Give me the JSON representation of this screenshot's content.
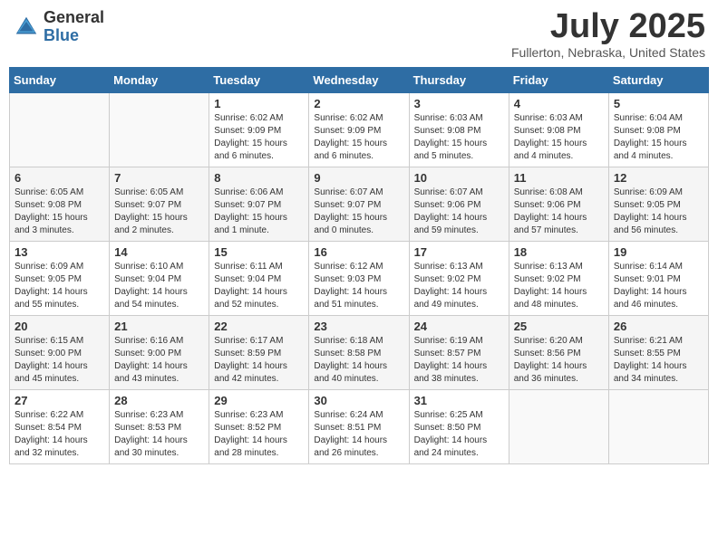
{
  "header": {
    "logo_general": "General",
    "logo_blue": "Blue",
    "month_year": "July 2025",
    "location": "Fullerton, Nebraska, United States"
  },
  "days_of_week": [
    "Sunday",
    "Monday",
    "Tuesday",
    "Wednesday",
    "Thursday",
    "Friday",
    "Saturday"
  ],
  "weeks": [
    [
      {
        "day": "",
        "sunrise": "",
        "sunset": "",
        "daylight": ""
      },
      {
        "day": "",
        "sunrise": "",
        "sunset": "",
        "daylight": ""
      },
      {
        "day": "1",
        "sunrise": "Sunrise: 6:02 AM",
        "sunset": "Sunset: 9:09 PM",
        "daylight": "Daylight: 15 hours and 6 minutes."
      },
      {
        "day": "2",
        "sunrise": "Sunrise: 6:02 AM",
        "sunset": "Sunset: 9:09 PM",
        "daylight": "Daylight: 15 hours and 6 minutes."
      },
      {
        "day": "3",
        "sunrise": "Sunrise: 6:03 AM",
        "sunset": "Sunset: 9:08 PM",
        "daylight": "Daylight: 15 hours and 5 minutes."
      },
      {
        "day": "4",
        "sunrise": "Sunrise: 6:03 AM",
        "sunset": "Sunset: 9:08 PM",
        "daylight": "Daylight: 15 hours and 4 minutes."
      },
      {
        "day": "5",
        "sunrise": "Sunrise: 6:04 AM",
        "sunset": "Sunset: 9:08 PM",
        "daylight": "Daylight: 15 hours and 4 minutes."
      }
    ],
    [
      {
        "day": "6",
        "sunrise": "Sunrise: 6:05 AM",
        "sunset": "Sunset: 9:08 PM",
        "daylight": "Daylight: 15 hours and 3 minutes."
      },
      {
        "day": "7",
        "sunrise": "Sunrise: 6:05 AM",
        "sunset": "Sunset: 9:07 PM",
        "daylight": "Daylight: 15 hours and 2 minutes."
      },
      {
        "day": "8",
        "sunrise": "Sunrise: 6:06 AM",
        "sunset": "Sunset: 9:07 PM",
        "daylight": "Daylight: 15 hours and 1 minute."
      },
      {
        "day": "9",
        "sunrise": "Sunrise: 6:07 AM",
        "sunset": "Sunset: 9:07 PM",
        "daylight": "Daylight: 15 hours and 0 minutes."
      },
      {
        "day": "10",
        "sunrise": "Sunrise: 6:07 AM",
        "sunset": "Sunset: 9:06 PM",
        "daylight": "Daylight: 14 hours and 59 minutes."
      },
      {
        "day": "11",
        "sunrise": "Sunrise: 6:08 AM",
        "sunset": "Sunset: 9:06 PM",
        "daylight": "Daylight: 14 hours and 57 minutes."
      },
      {
        "day": "12",
        "sunrise": "Sunrise: 6:09 AM",
        "sunset": "Sunset: 9:05 PM",
        "daylight": "Daylight: 14 hours and 56 minutes."
      }
    ],
    [
      {
        "day": "13",
        "sunrise": "Sunrise: 6:09 AM",
        "sunset": "Sunset: 9:05 PM",
        "daylight": "Daylight: 14 hours and 55 minutes."
      },
      {
        "day": "14",
        "sunrise": "Sunrise: 6:10 AM",
        "sunset": "Sunset: 9:04 PM",
        "daylight": "Daylight: 14 hours and 54 minutes."
      },
      {
        "day": "15",
        "sunrise": "Sunrise: 6:11 AM",
        "sunset": "Sunset: 9:04 PM",
        "daylight": "Daylight: 14 hours and 52 minutes."
      },
      {
        "day": "16",
        "sunrise": "Sunrise: 6:12 AM",
        "sunset": "Sunset: 9:03 PM",
        "daylight": "Daylight: 14 hours and 51 minutes."
      },
      {
        "day": "17",
        "sunrise": "Sunrise: 6:13 AM",
        "sunset": "Sunset: 9:02 PM",
        "daylight": "Daylight: 14 hours and 49 minutes."
      },
      {
        "day": "18",
        "sunrise": "Sunrise: 6:13 AM",
        "sunset": "Sunset: 9:02 PM",
        "daylight": "Daylight: 14 hours and 48 minutes."
      },
      {
        "day": "19",
        "sunrise": "Sunrise: 6:14 AM",
        "sunset": "Sunset: 9:01 PM",
        "daylight": "Daylight: 14 hours and 46 minutes."
      }
    ],
    [
      {
        "day": "20",
        "sunrise": "Sunrise: 6:15 AM",
        "sunset": "Sunset: 9:00 PM",
        "daylight": "Daylight: 14 hours and 45 minutes."
      },
      {
        "day": "21",
        "sunrise": "Sunrise: 6:16 AM",
        "sunset": "Sunset: 9:00 PM",
        "daylight": "Daylight: 14 hours and 43 minutes."
      },
      {
        "day": "22",
        "sunrise": "Sunrise: 6:17 AM",
        "sunset": "Sunset: 8:59 PM",
        "daylight": "Daylight: 14 hours and 42 minutes."
      },
      {
        "day": "23",
        "sunrise": "Sunrise: 6:18 AM",
        "sunset": "Sunset: 8:58 PM",
        "daylight": "Daylight: 14 hours and 40 minutes."
      },
      {
        "day": "24",
        "sunrise": "Sunrise: 6:19 AM",
        "sunset": "Sunset: 8:57 PM",
        "daylight": "Daylight: 14 hours and 38 minutes."
      },
      {
        "day": "25",
        "sunrise": "Sunrise: 6:20 AM",
        "sunset": "Sunset: 8:56 PM",
        "daylight": "Daylight: 14 hours and 36 minutes."
      },
      {
        "day": "26",
        "sunrise": "Sunrise: 6:21 AM",
        "sunset": "Sunset: 8:55 PM",
        "daylight": "Daylight: 14 hours and 34 minutes."
      }
    ],
    [
      {
        "day": "27",
        "sunrise": "Sunrise: 6:22 AM",
        "sunset": "Sunset: 8:54 PM",
        "daylight": "Daylight: 14 hours and 32 minutes."
      },
      {
        "day": "28",
        "sunrise": "Sunrise: 6:23 AM",
        "sunset": "Sunset: 8:53 PM",
        "daylight": "Daylight: 14 hours and 30 minutes."
      },
      {
        "day": "29",
        "sunrise": "Sunrise: 6:23 AM",
        "sunset": "Sunset: 8:52 PM",
        "daylight": "Daylight: 14 hours and 28 minutes."
      },
      {
        "day": "30",
        "sunrise": "Sunrise: 6:24 AM",
        "sunset": "Sunset: 8:51 PM",
        "daylight": "Daylight: 14 hours and 26 minutes."
      },
      {
        "day": "31",
        "sunrise": "Sunrise: 6:25 AM",
        "sunset": "Sunset: 8:50 PM",
        "daylight": "Daylight: 14 hours and 24 minutes."
      },
      {
        "day": "",
        "sunrise": "",
        "sunset": "",
        "daylight": ""
      },
      {
        "day": "",
        "sunrise": "",
        "sunset": "",
        "daylight": ""
      }
    ]
  ]
}
